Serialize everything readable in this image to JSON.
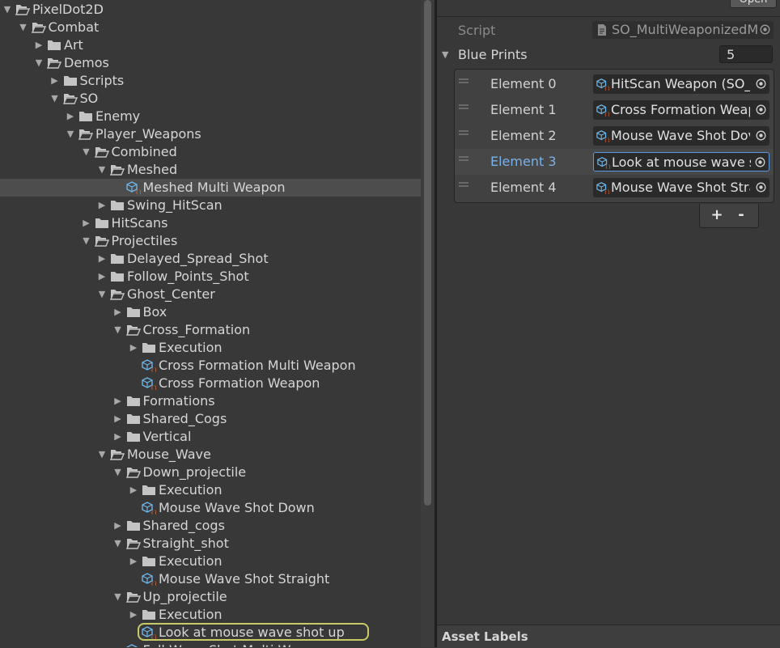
{
  "tree": {
    "rows": [
      {
        "label": "PixelDot2D",
        "depth": 0,
        "arrow": "down",
        "icon": "folder-open-icon"
      },
      {
        "label": "Combat",
        "depth": 1,
        "arrow": "down",
        "icon": "folder-open-icon"
      },
      {
        "label": "Art",
        "depth": 2,
        "arrow": "right",
        "icon": "folder-icon"
      },
      {
        "label": "Demos",
        "depth": 2,
        "arrow": "down",
        "icon": "folder-open-icon"
      },
      {
        "label": "Scripts",
        "depth": 3,
        "arrow": "right",
        "icon": "folder-icon"
      },
      {
        "label": "SO",
        "depth": 3,
        "arrow": "down",
        "icon": "folder-open-icon"
      },
      {
        "label": "Enemy",
        "depth": 4,
        "arrow": "right",
        "icon": "folder-icon"
      },
      {
        "label": "Player_Weapons",
        "depth": 4,
        "arrow": "down",
        "icon": "folder-open-icon"
      },
      {
        "label": "Combined",
        "depth": 5,
        "arrow": "down",
        "icon": "folder-open-icon"
      },
      {
        "label": "Meshed",
        "depth": 6,
        "arrow": "down",
        "icon": "folder-open-icon"
      },
      {
        "label": "Meshed Multi Weapon",
        "depth": 7,
        "arrow": "",
        "icon": "scriptable-object-icon",
        "selected": true
      },
      {
        "label": "Swing_HitScan",
        "depth": 6,
        "arrow": "right",
        "icon": "folder-icon"
      },
      {
        "label": "HitScans",
        "depth": 5,
        "arrow": "right",
        "icon": "folder-icon"
      },
      {
        "label": "Projectiles",
        "depth": 5,
        "arrow": "down",
        "icon": "folder-open-icon"
      },
      {
        "label": "Delayed_Spread_Shot",
        "depth": 6,
        "arrow": "right",
        "icon": "folder-icon"
      },
      {
        "label": "Follow_Points_Shot",
        "depth": 6,
        "arrow": "right",
        "icon": "folder-icon"
      },
      {
        "label": "Ghost_Center",
        "depth": 6,
        "arrow": "down",
        "icon": "folder-open-icon"
      },
      {
        "label": "Box",
        "depth": 7,
        "arrow": "right",
        "icon": "folder-icon"
      },
      {
        "label": "Cross_Formation",
        "depth": 7,
        "arrow": "down",
        "icon": "folder-open-icon"
      },
      {
        "label": "Execution",
        "depth": 8,
        "arrow": "right",
        "icon": "folder-icon"
      },
      {
        "label": "Cross Formation Multi Weapon",
        "depth": 8,
        "arrow": "",
        "icon": "scriptable-object-icon"
      },
      {
        "label": "Cross Formation Weapon",
        "depth": 8,
        "arrow": "",
        "icon": "scriptable-object-icon"
      },
      {
        "label": "Formations",
        "depth": 7,
        "arrow": "right",
        "icon": "folder-icon"
      },
      {
        "label": "Shared_Cogs",
        "depth": 7,
        "arrow": "right",
        "icon": "folder-icon"
      },
      {
        "label": "Vertical",
        "depth": 7,
        "arrow": "right",
        "icon": "folder-icon"
      },
      {
        "label": "Mouse_Wave",
        "depth": 6,
        "arrow": "down",
        "icon": "folder-open-icon"
      },
      {
        "label": "Down_projectile",
        "depth": 7,
        "arrow": "down",
        "icon": "folder-open-icon"
      },
      {
        "label": "Execution",
        "depth": 8,
        "arrow": "right",
        "icon": "folder-icon"
      },
      {
        "label": "Mouse Wave Shot Down",
        "depth": 8,
        "arrow": "",
        "icon": "scriptable-object-icon"
      },
      {
        "label": "Shared_cogs",
        "depth": 7,
        "arrow": "right",
        "icon": "folder-icon"
      },
      {
        "label": "Straight_shot",
        "depth": 7,
        "arrow": "down",
        "icon": "folder-open-icon"
      },
      {
        "label": "Execution",
        "depth": 8,
        "arrow": "right",
        "icon": "folder-icon"
      },
      {
        "label": "Mouse Wave Shot Straight",
        "depth": 8,
        "arrow": "",
        "icon": "scriptable-object-icon"
      },
      {
        "label": "Up_projectile",
        "depth": 7,
        "arrow": "down",
        "icon": "folder-open-icon"
      },
      {
        "label": "Execution",
        "depth": 8,
        "arrow": "right",
        "icon": "folder-icon"
      },
      {
        "label": "Look at mouse wave shot up",
        "depth": 8,
        "arrow": "",
        "icon": "scriptable-object-icon",
        "highlighted": true
      },
      {
        "label": "Full Wave Shot Multi Weapon",
        "depth": 7,
        "arrow": "",
        "icon": "scriptable-object-icon"
      }
    ]
  },
  "inspector": {
    "open_label": "Open",
    "script_label": "Script",
    "script_value": "SO_MultiWeaponizedM",
    "blueprints_label": "Blue Prints",
    "blueprints_count": "5",
    "elements": [
      {
        "name": "Element 0",
        "value": "HitScan Weapon (SO_",
        "active": false
      },
      {
        "name": "Element 1",
        "value": "Cross Formation Weap",
        "active": false
      },
      {
        "name": "Element 2",
        "value": "Mouse Wave Shot Dov",
        "active": false
      },
      {
        "name": "Element 3",
        "value": "Look at mouse wave s",
        "active": true
      },
      {
        "name": "Element 4",
        "value": "Mouse Wave Shot Stra",
        "active": false
      }
    ],
    "plus_label": "+",
    "minus_label": "-",
    "asset_labels": "Asset Labels"
  },
  "colors": {
    "folder": "#c4c4c4",
    "so_cube": "#6fb6e8",
    "so_braces": "#e0683c",
    "active_text": "#7ab0e8",
    "highlight_outline": "#c9c96a"
  }
}
